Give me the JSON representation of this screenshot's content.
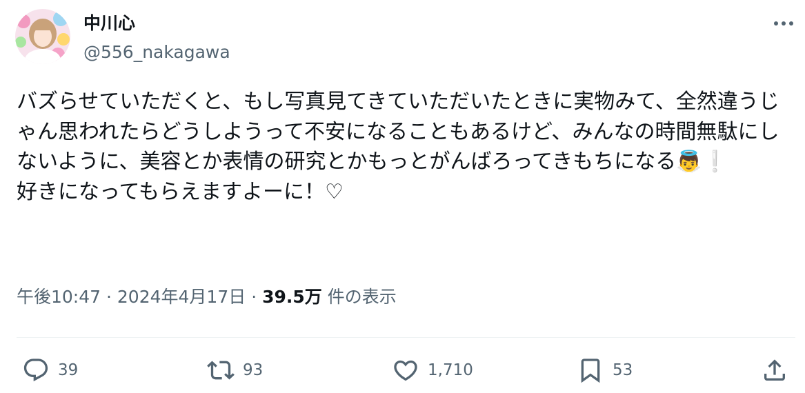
{
  "user": {
    "display_name": "中川心",
    "handle": "@556_nakagawa",
    "avatar_icon": "profile-photo-avatar"
  },
  "tweet": {
    "text": "バズらせていただくと、もし写真見てきていただいたときに実物みて、全然違うじゃん思われたらどうしようって不安になることもあるけど、みんなの時間無駄にしないように、美容とか表情の研究とかもっとがんばろってきもちになる👼❕\n好きになってもらえますよーに！♡"
  },
  "meta": {
    "time": "午後10:47",
    "separator": "·",
    "date": "2024年4月17日",
    "views_count": "39.5万",
    "views_label": "件の表示"
  },
  "actions": {
    "reply_count": "39",
    "retweet_count": "93",
    "like_count": "1,710",
    "bookmark_count": "53"
  },
  "icons": {
    "more": "more-dots-icon",
    "reply": "reply-bubble-icon",
    "retweet": "retweet-icon",
    "like": "heart-icon",
    "bookmark": "bookmark-icon",
    "share": "share-upload-icon"
  },
  "colors": {
    "text": "#0f1419",
    "secondary": "#536471",
    "divider": "#eff3f4"
  }
}
